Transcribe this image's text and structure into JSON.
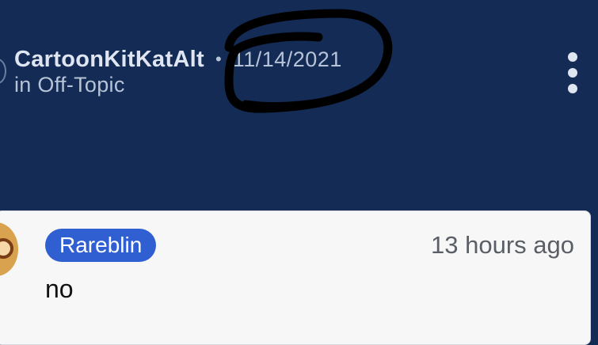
{
  "post": {
    "author": "CartoonKitKatAlt",
    "separator": "•",
    "date": "11/14/2021",
    "category": "in Off-Topic",
    "menu_icon": "more-vertical-icon"
  },
  "comment": {
    "username": "Rareblin",
    "time": "13 hours ago",
    "text": "no"
  },
  "colors": {
    "header_bg": "#132b55",
    "header_text": "#dfe6f1",
    "muted_text": "#b7c3d6",
    "card_bg": "#f7f7f8",
    "chip_bg": "#2f5fd0",
    "scribble": "#000000"
  }
}
